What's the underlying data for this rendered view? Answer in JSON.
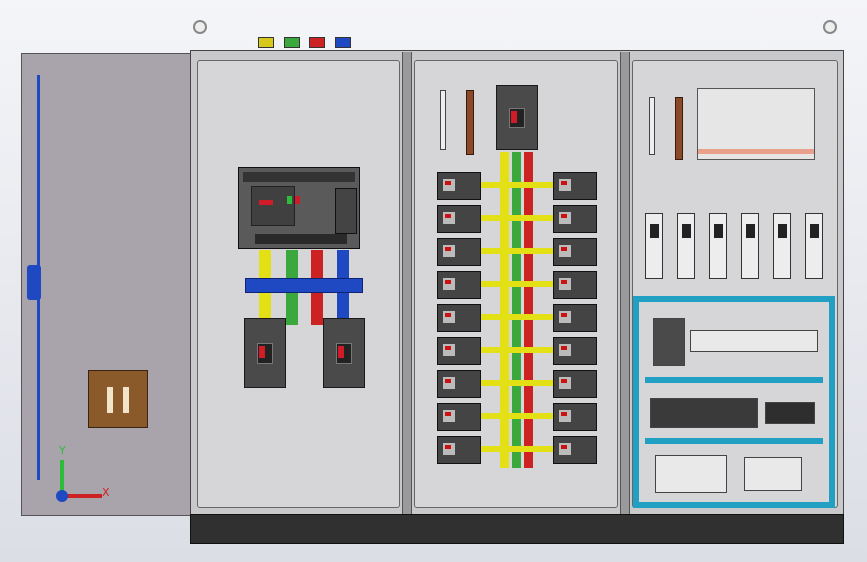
{
  "breaker_labels": {
    "main": "",
    "feeder": ""
  },
  "colors": {
    "phase_yellow": "#e3e016",
    "phase_green": "#3aa83c",
    "phase_red": "#cc2222",
    "neutral_blue": "#1f49c2",
    "din_rail": "#21a0c4",
    "door": "#a9a3ab",
    "plinth": "#303030"
  },
  "axis_triad": {
    "x_label": "X",
    "y_label": "Y"
  },
  "icons": [
    "lifting-eye-icon",
    "axis-triad-icon",
    "door-handle-icon"
  ]
}
